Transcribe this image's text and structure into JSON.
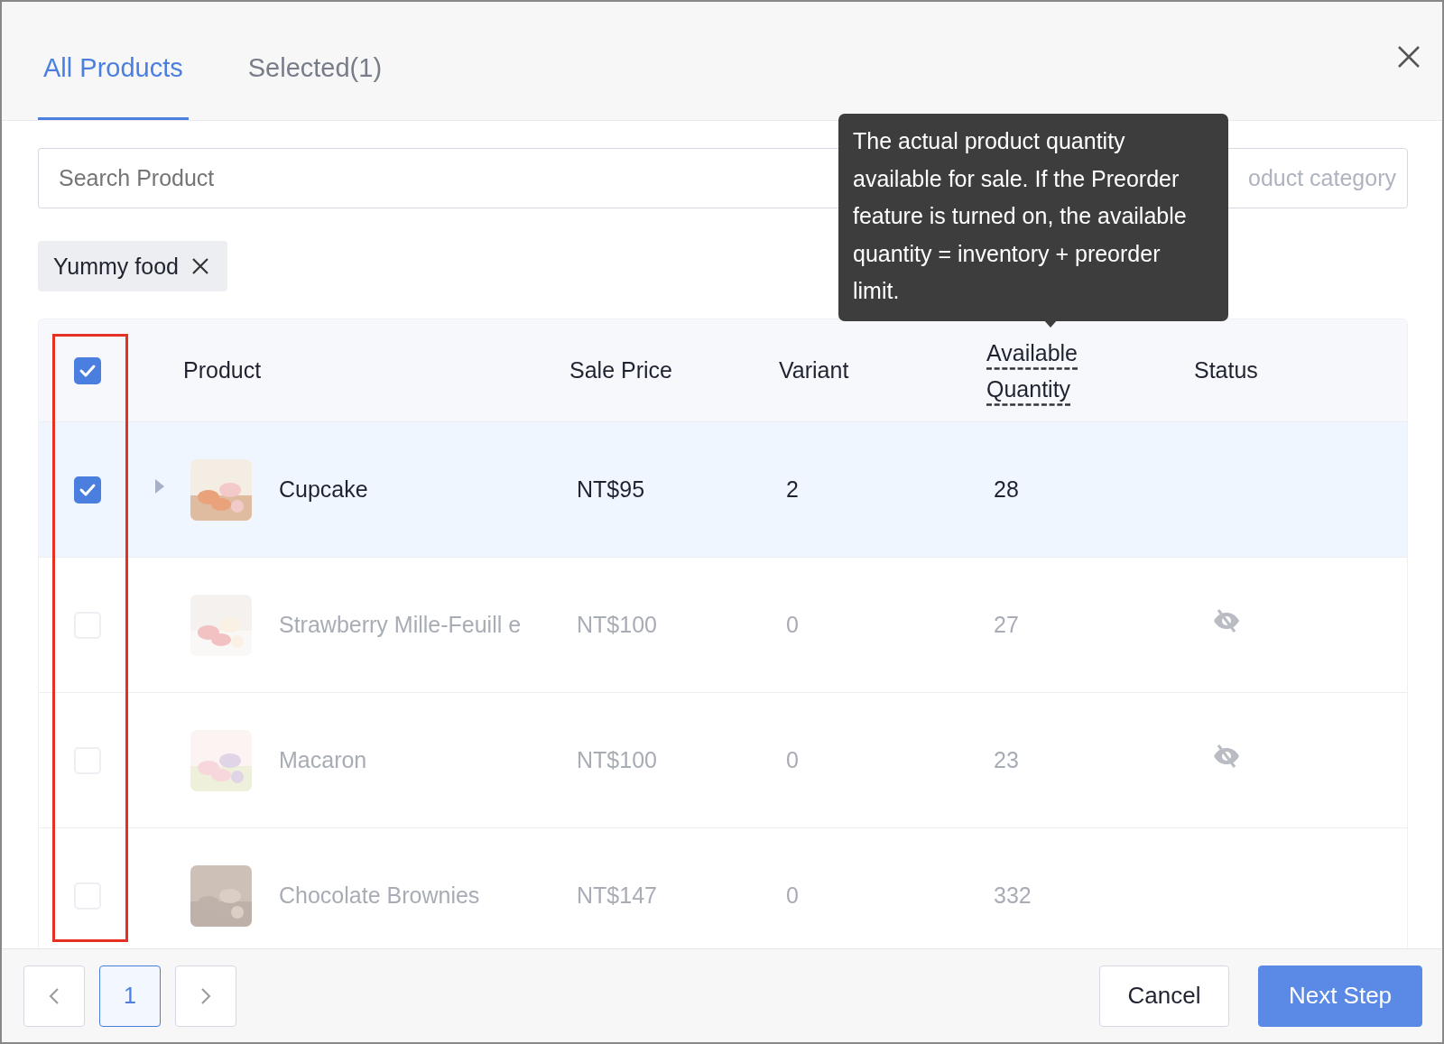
{
  "tabs": [
    {
      "label": "All Products",
      "selected": true
    },
    {
      "label": "Selected(1)",
      "selected": false
    }
  ],
  "search": {
    "placeholder": "Search Product"
  },
  "category": {
    "placeholder": "oduct category"
  },
  "tags": [
    {
      "label": "Yummy food"
    }
  ],
  "table": {
    "all_checked": true,
    "columns": [
      "Product",
      "Sale Price",
      "Variant",
      "Available Quantity",
      "Status"
    ],
    "rows": [
      {
        "name": "Cupcake",
        "price": "NT$95",
        "variant": "2",
        "quantity": "28",
        "checked": true,
        "disabled": false,
        "expandable": true,
        "hidden": false
      },
      {
        "name": "Strawberry Mille-Feuill e",
        "price": "NT$100",
        "variant": "0",
        "quantity": "27",
        "checked": false,
        "disabled": true,
        "expandable": false,
        "hidden": true
      },
      {
        "name": "Macaron",
        "price": "NT$100",
        "variant": "0",
        "quantity": "23",
        "checked": false,
        "disabled": true,
        "expandable": false,
        "hidden": true
      },
      {
        "name": "Chocolate Brownies",
        "price": "NT$147",
        "variant": "0",
        "quantity": "332",
        "checked": false,
        "disabled": true,
        "expandable": false,
        "hidden": false
      }
    ]
  },
  "tooltip": {
    "text": "The actual product quantity available for sale. If the Preorder feature is turned on, the available quantity = inventory + preorder limit."
  },
  "pagination": {
    "pages": [
      {
        "label": "1",
        "selected": true
      }
    ]
  },
  "buttons": [
    {
      "label": "Cancel",
      "kind": "secondary"
    },
    {
      "label": "Next Step",
      "kind": "primary"
    }
  ]
}
